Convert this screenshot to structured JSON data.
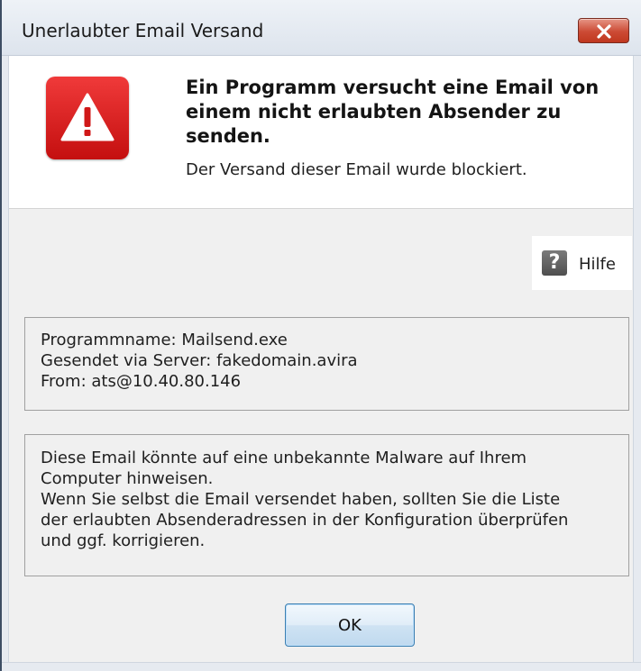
{
  "window": {
    "title": "Unerlaubter Email Versand"
  },
  "header": {
    "icon": "warning-triangle-icon",
    "headline_lines": [
      "Ein Programm versucht eine Email von",
      "einem nicht erlaubten Absender zu",
      "senden."
    ],
    "subline": "Der Versand dieser Email wurde blockiert."
  },
  "help": {
    "icon": "question-icon",
    "icon_glyph": "?",
    "label": "Hilfe"
  },
  "info": {
    "lines": [
      "Programmname: Mailsend.exe",
      "Gesendet via Server: fakedomain.avira",
      "From: ats@10.40.80.146"
    ]
  },
  "notice": {
    "lines": [
      "Diese Email könnte auf eine unbekannte Malware auf Ihrem",
      "Computer hinweisen.",
      "Wenn Sie selbst die Email versendet haben, sollten Sie die Liste",
      "der erlaubten Absenderadressen in der Konfiguration überprüfen",
      "und ggf. korrigieren."
    ]
  },
  "buttons": {
    "ok_label": "OK"
  },
  "colors": {
    "warning_red": "#d81f1f",
    "close_red": "#c84432",
    "button_border": "#3c7fb1"
  }
}
